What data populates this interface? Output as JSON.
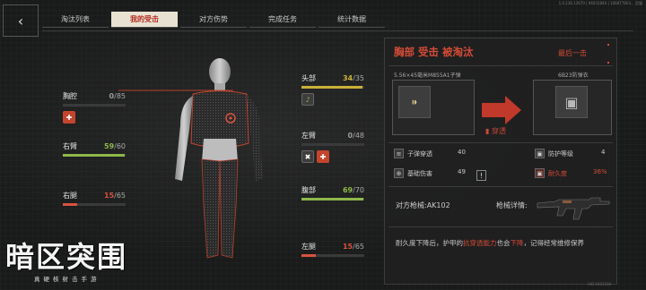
{
  "meta": {
    "build": "1.0.136.13670 | 94031840 | 106877803... 官服"
  },
  "nav": {
    "back_icon": "chevron-left-icon",
    "tabs": [
      {
        "label": "淘汰列表",
        "active": false
      },
      {
        "label": "我的受击",
        "active": true
      },
      {
        "label": "对方伤势",
        "active": false
      },
      {
        "label": "完成任务",
        "active": false
      },
      {
        "label": "统计数据",
        "active": false
      }
    ]
  },
  "body_parts": {
    "chest": {
      "label": "胸腔",
      "current": "0",
      "max": "/85",
      "fraction": 0.0,
      "color": "#9a9a9a"
    },
    "right_arm": {
      "label": "右臂",
      "current": "59",
      "max": "/60",
      "fraction": 0.983,
      "color": "#8eb84a"
    },
    "right_leg": {
      "label": "右腿",
      "current": "15",
      "max": "/65",
      "fraction": 0.23,
      "color": "#d8533e"
    },
    "head": {
      "label": "头部",
      "current": "34",
      "max": "/35",
      "fraction": 0.97,
      "color": "#c9b13a"
    },
    "left_arm": {
      "label": "左臂",
      "current": "0",
      "max": "/48",
      "fraction": 0.0,
      "color": "#9a9a9a"
    },
    "abdomen": {
      "label": "腹部",
      "current": "69",
      "max": "/70",
      "fraction": 0.985,
      "color": "#8eb84a"
    },
    "left_leg": {
      "label": "左腿",
      "current": "15",
      "max": "/65",
      "fraction": 0.23,
      "color": "#d8533e"
    }
  },
  "panel": {
    "headline": "胸部  受击  被淘汰",
    "last_hit": "最后一击",
    "ammo": {
      "name": "5.56×45毫米M855A1子弹",
      "stats": [
        {
          "label": "子弹穿透",
          "value": "40"
        },
        {
          "label": "基础伤害",
          "value": "49"
        }
      ]
    },
    "penetrate_label": "穿透",
    "warning_glyph": "!",
    "armor": {
      "name": "6B23防弹衣",
      "stats": [
        {
          "label": "防护等级",
          "value": "4",
          "highlight": false
        },
        {
          "label": "耐久度",
          "value": "36%",
          "highlight": true
        }
      ]
    },
    "enemy_weapon": "对方枪械:AK102",
    "weapon_detail": "枪械详情:",
    "note": {
      "pre": "耐久度下降后，护甲的",
      "hl1": "抗穿透能力",
      "mid": "也会",
      "hl2": "下降",
      "post": "，记得经常维修保养"
    }
  },
  "logo": {
    "title": "暗区突围",
    "subtitle": "真硬核射击手游"
  },
  "footer_id": "UID:9403184"
}
